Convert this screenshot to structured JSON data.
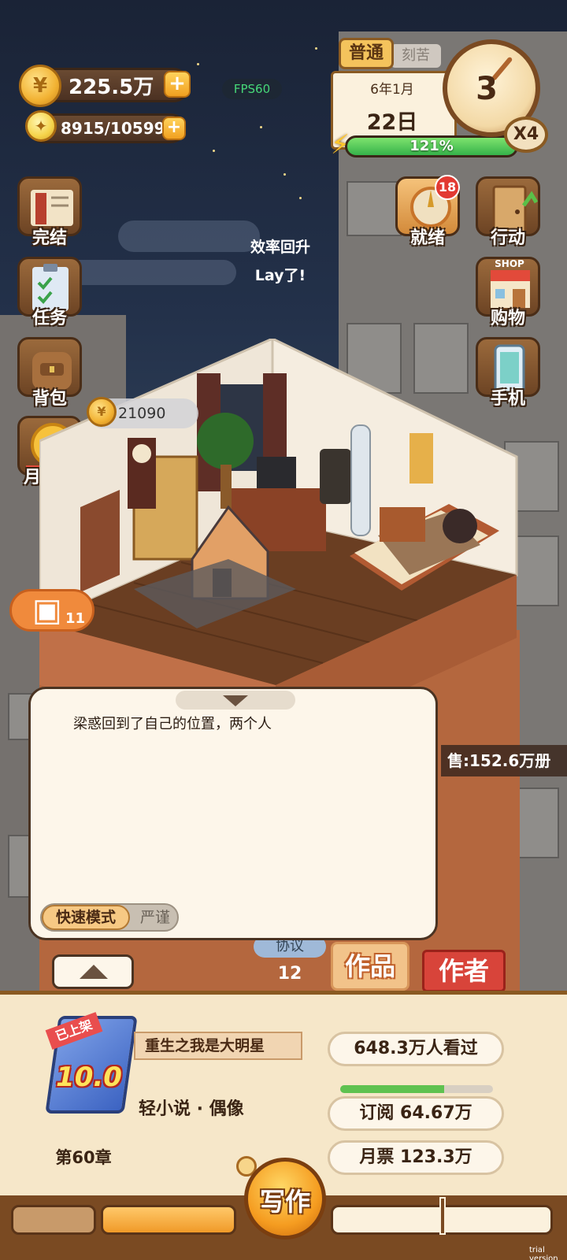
{
  "hud": {
    "money": "225.5万",
    "energy": "8915/10599",
    "fps": "FPS60"
  },
  "date": {
    "mode_active": "普通",
    "mode_other": "刻苦",
    "month": "6年1月",
    "day": "22日",
    "efficiency": "121%",
    "efficiency_fraction": 1.0
  },
  "clock": {
    "number": "3",
    "speed": "X4"
  },
  "left_menu": [
    {
      "label": "完结",
      "icon": "book-icon"
    },
    {
      "label": "任务",
      "icon": "clipboard-icon"
    },
    {
      "label": "背包",
      "icon": "backpack-icon"
    },
    {
      "label": "月票榜",
      "icon": "ticket-medal-icon"
    }
  ],
  "right_menu": [
    {
      "label": "就绪",
      "icon": "bell-icon",
      "badge": "18"
    },
    {
      "label": "行动",
      "icon": "door-icon"
    },
    {
      "label": "购物",
      "icon": "shop-icon",
      "sign": "SHOP"
    },
    {
      "label": "手机",
      "icon": "phone-icon"
    }
  ],
  "floating_text": {
    "line1": "效率回升",
    "line2": "Lay了!"
  },
  "room": {
    "coin_count": "21090",
    "chest_count": "11"
  },
  "sales": "售:152.6万册",
  "dialog": {
    "text": "梁惑回到了自己的位置，两个人",
    "mode_fast": "快速模式",
    "mode_strict": "严谨"
  },
  "mid_tabs": {
    "agree_label": "协议",
    "agree_count": "12",
    "works_label": "作品",
    "author_label": "作者"
  },
  "book": {
    "tag": "已上架",
    "score": "10.0",
    "chapter": "第60章",
    "title": "重生之我是大明星",
    "genre": "轻小说 · 偶像"
  },
  "stats": {
    "views": "648.3万人看过",
    "views_fraction": 0.68,
    "subscribe": "订阅  64.67万",
    "monthly": "月票  123.3万"
  },
  "write_button": "写作",
  "watermark": "trial version",
  "colors": {
    "accent_orange": "#f59c20",
    "panel_bg": "#f6e7c9",
    "brown_border": "#7a4a22",
    "energy_green": "#35b24a",
    "author_red": "#d8443a"
  }
}
